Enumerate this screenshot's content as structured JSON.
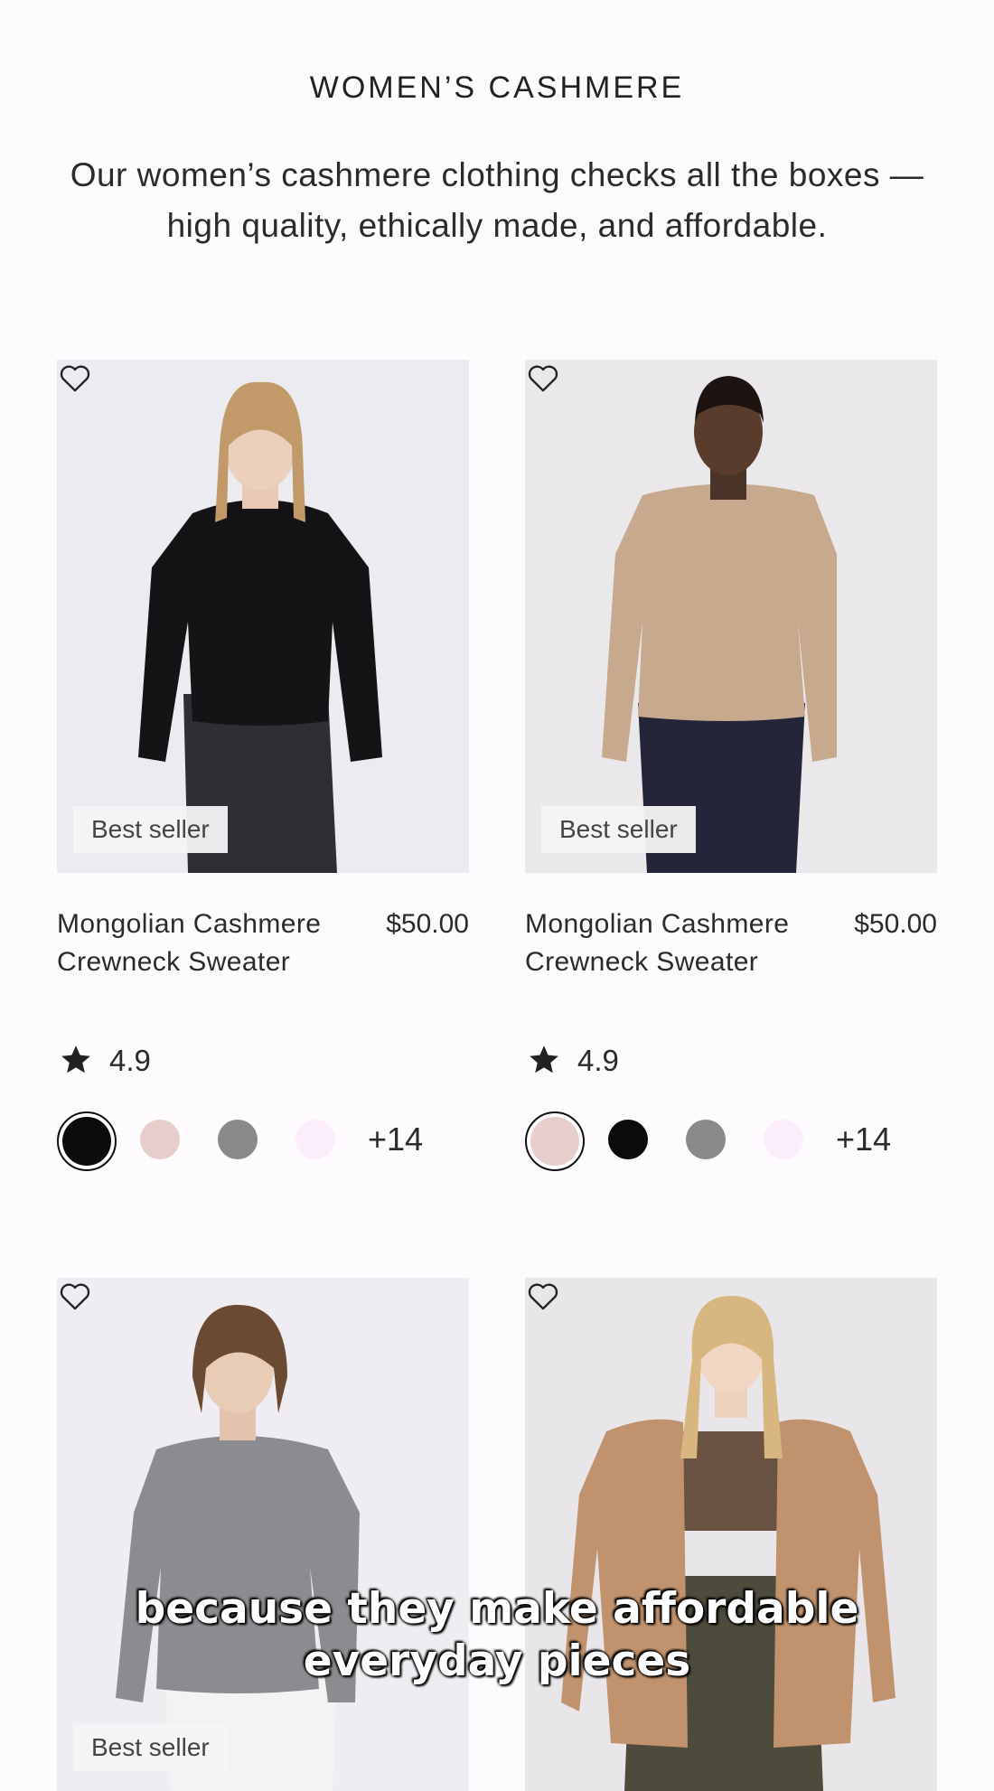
{
  "page": {
    "title": "WOMEN’S CASHMERE",
    "description": "Our women’s cashmere clothing checks all the boxes —high quality, ethically made, and affordable."
  },
  "products": [
    {
      "badge": "Best seller",
      "name": "Mongolian Cashmere Crewneck Sweater",
      "price": "$50.00",
      "rating": "4.9",
      "more_colors": "+14",
      "swatches": [
        "#0b0b0e",
        "#e6cfca",
        "#8a898c",
        "#fbeefa"
      ],
      "selected_swatch": 0,
      "sweater_color": "#141416",
      "pants_color": "#2f2f33"
    },
    {
      "badge": "Best seller",
      "name": "Mongolian Cashmere Crewneck Sweater",
      "price": "$50.00",
      "rating": "4.9",
      "more_colors": "+14",
      "swatches": [
        "#e6cfca",
        "#0b0b0e",
        "#8a898c",
        "#fbeefa"
      ],
      "selected_swatch": 0,
      "sweater_color": "#c7a98d",
      "pants_color": "#242538"
    },
    {
      "badge": "Best seller",
      "sweater_color": "#8c8b90",
      "pants_color": "#f4f3f3"
    },
    {
      "sweater_color": "#c0936e",
      "pants_color": "#4e4a3c"
    }
  ],
  "caption": {
    "line1": "because they make affordable",
    "line2": "everyday pieces"
  },
  "icons": {
    "favorite": "heart-outline-icon",
    "rating": "star-icon"
  }
}
